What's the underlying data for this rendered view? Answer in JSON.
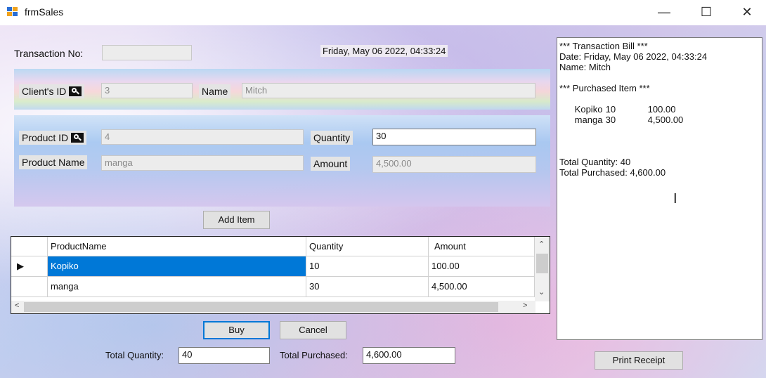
{
  "window": {
    "title": "frmSales",
    "minimize": "—",
    "maximize": "☐",
    "close": "✕"
  },
  "transaction": {
    "label": "Transaction No:",
    "value": "",
    "datetime": "Friday, May 06 2022, 04:33:24"
  },
  "client": {
    "id_label": "Client's ID",
    "id_value": "3",
    "name_label": "Name",
    "name_value": "Mitch"
  },
  "product": {
    "id_label": "Product ID",
    "id_value": "4",
    "name_label": "Product Name",
    "name_value": "manga",
    "quantity_label": "Quantity",
    "quantity_value": "30",
    "amount_label": "Amount",
    "amount_value": "4,500.00"
  },
  "buttons": {
    "add_item": "Add Item",
    "buy": "Buy",
    "cancel": "Cancel",
    "print_receipt": "Print Receipt"
  },
  "grid": {
    "columns": [
      "ProductName",
      "Quantity",
      "Amount"
    ],
    "rows": [
      {
        "name": "Kopiko",
        "quantity": "10",
        "amount": "100.00"
      },
      {
        "name": "manga",
        "quantity": "30",
        "amount": "4,500.00"
      }
    ]
  },
  "totals": {
    "quantity_label": "Total Quantity:",
    "quantity_value": "40",
    "purchased_label": "Total Purchased:",
    "purchased_value": "4,600.00"
  },
  "receipt": {
    "header": "*** Transaction Bill ***",
    "date": "Date: Friday, May 06 2022, 04:33:24",
    "name": "Name: Mitch",
    "items_header": "*** Purchased Item ***",
    "items": [
      {
        "name": "Kopiko",
        "qty": "10",
        "amount": "100.00"
      },
      {
        "name": "manga",
        "qty": "30",
        "amount": "4,500.00"
      }
    ],
    "total_quantity": "Total Quantity: 40",
    "total_purchased": "Total Purchased: 4,600.00"
  },
  "colors": {
    "selection": "#0078d7",
    "default_button_border": "#0078d7"
  }
}
